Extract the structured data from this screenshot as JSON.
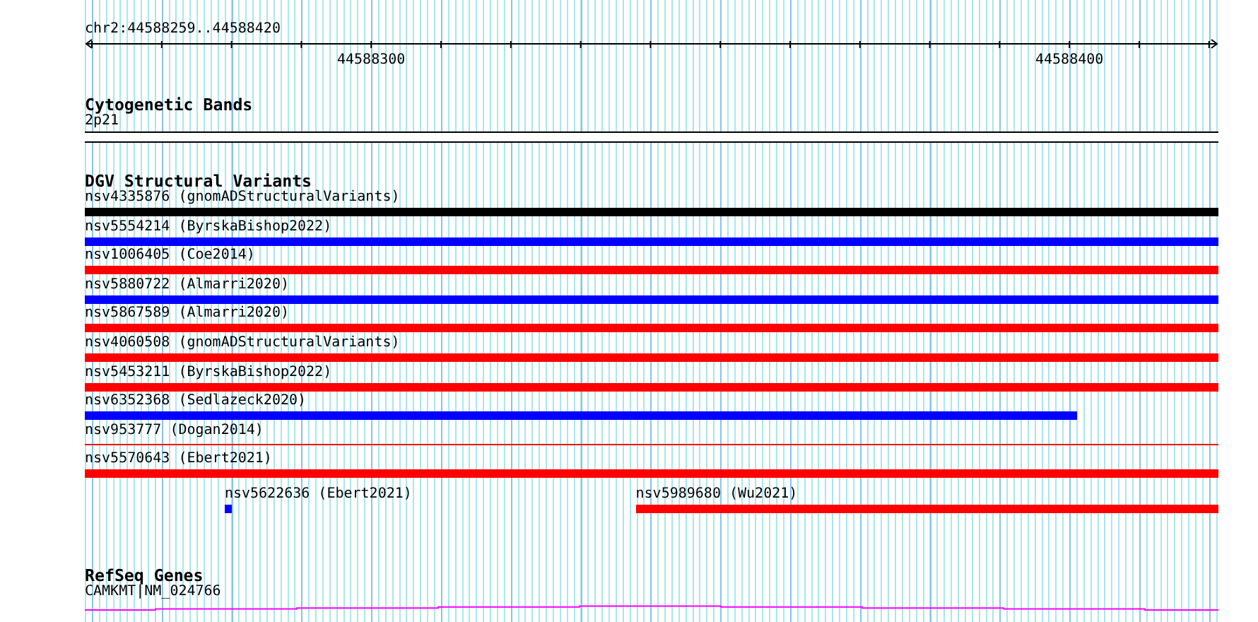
{
  "location": "chr2:44588259..44588420",
  "ruler": {
    "tick_labels": [
      "44588300",
      "44588400"
    ]
  },
  "tracks": [
    {
      "kind": "band",
      "title": "Cytogenetic Bands",
      "features": [
        {
          "label": "2p21"
        }
      ]
    },
    {
      "kind": "variants",
      "title": "DGV Structural Variants",
      "rows": [
        {
          "features": [
            {
              "label": "nsv4335876 (gnomADStructuralVariants)",
              "color": "#000000",
              "kind": "thick"
            }
          ]
        },
        {
          "features": [
            {
              "label": "nsv5554214 (ByrskaBishop2022)",
              "color": "#0000ff",
              "kind": "thick"
            }
          ]
        },
        {
          "features": [
            {
              "label": "nsv1006405 (Coe2014)",
              "color": "#ff0000",
              "kind": "thick"
            }
          ]
        },
        {
          "features": [
            {
              "label": "nsv5880722 (Almarri2020)",
              "color": "#0000ff",
              "kind": "thick"
            }
          ]
        },
        {
          "features": [
            {
              "label": "nsv5867589 (Almarri2020)",
              "color": "#ff0000",
              "kind": "thick"
            }
          ]
        },
        {
          "features": [
            {
              "label": "nsv4060508 (gnomADStructuralVariants)",
              "color": "#ff0000",
              "kind": "thick"
            }
          ]
        },
        {
          "features": [
            {
              "label": "nsv5453211 (ByrskaBishop2022)",
              "color": "#ff0000",
              "kind": "thick"
            }
          ]
        },
        {
          "features": [
            {
              "label": "nsv6352368 (Sedlazeck2020)",
              "color": "#0000ff",
              "kind": "thick"
            }
          ]
        },
        {
          "features": [
            {
              "label": "nsv953777 (Dogan2014)",
              "color": "#ff0000",
              "kind": "thin"
            }
          ]
        },
        {
          "features": [
            {
              "label": "nsv5570643 (Ebert2021)",
              "color": "#ff0000",
              "kind": "thick"
            }
          ]
        },
        {
          "features": [
            {
              "label": "nsv5622636 (Ebert2021)",
              "color": "#0000ff",
              "kind": "thick"
            },
            {
              "label": "nsv5989680 (Wu2021)",
              "color": "#ff0000",
              "kind": "thick"
            }
          ]
        }
      ]
    },
    {
      "kind": "gene",
      "title": "RefSeq Genes",
      "features": [
        {
          "label": "CAMKMT|NM_024766",
          "color": "#ff00ff"
        }
      ]
    }
  ]
}
